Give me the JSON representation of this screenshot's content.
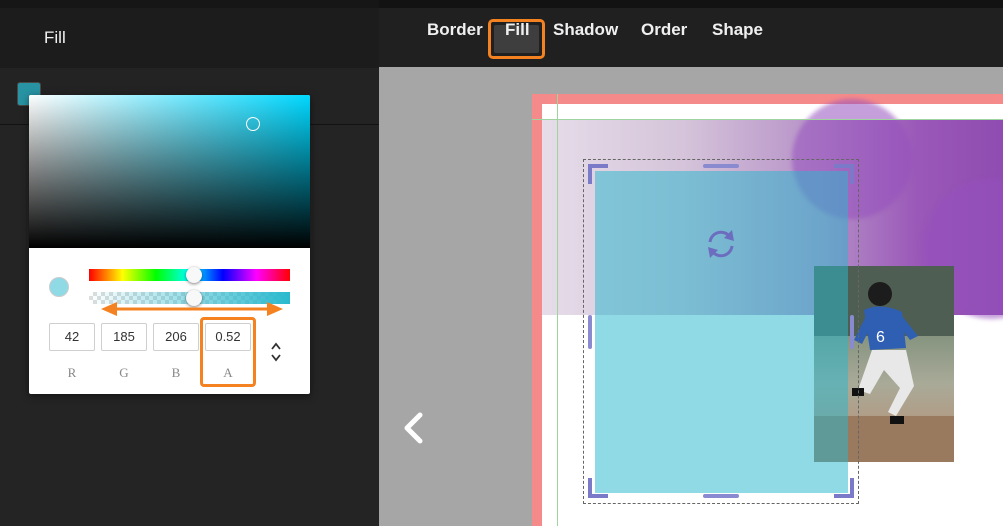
{
  "left_panel": {
    "title": "Fill"
  },
  "color_picker": {
    "channels": [
      {
        "label": "R",
        "value": "42"
      },
      {
        "label": "G",
        "value": "185"
      },
      {
        "label": "B",
        "value": "206"
      },
      {
        "label": "A",
        "value": "0.52"
      }
    ],
    "hue_position": 0.52,
    "alpha_position": 0.52,
    "current_color": "#2ab9ce"
  },
  "toolbar": {
    "tabs": [
      "Border",
      "Fill",
      "Shadow",
      "Order",
      "Shape"
    ],
    "active_tab": "Fill"
  },
  "canvas": {
    "prev_icon": "chevron-left-icon",
    "rotate_icon": "rotate-icon"
  },
  "colors": {
    "accent_highlight": "#f58220",
    "page_border": "#f58a8a",
    "selection_handles": "#7a7ac8"
  }
}
